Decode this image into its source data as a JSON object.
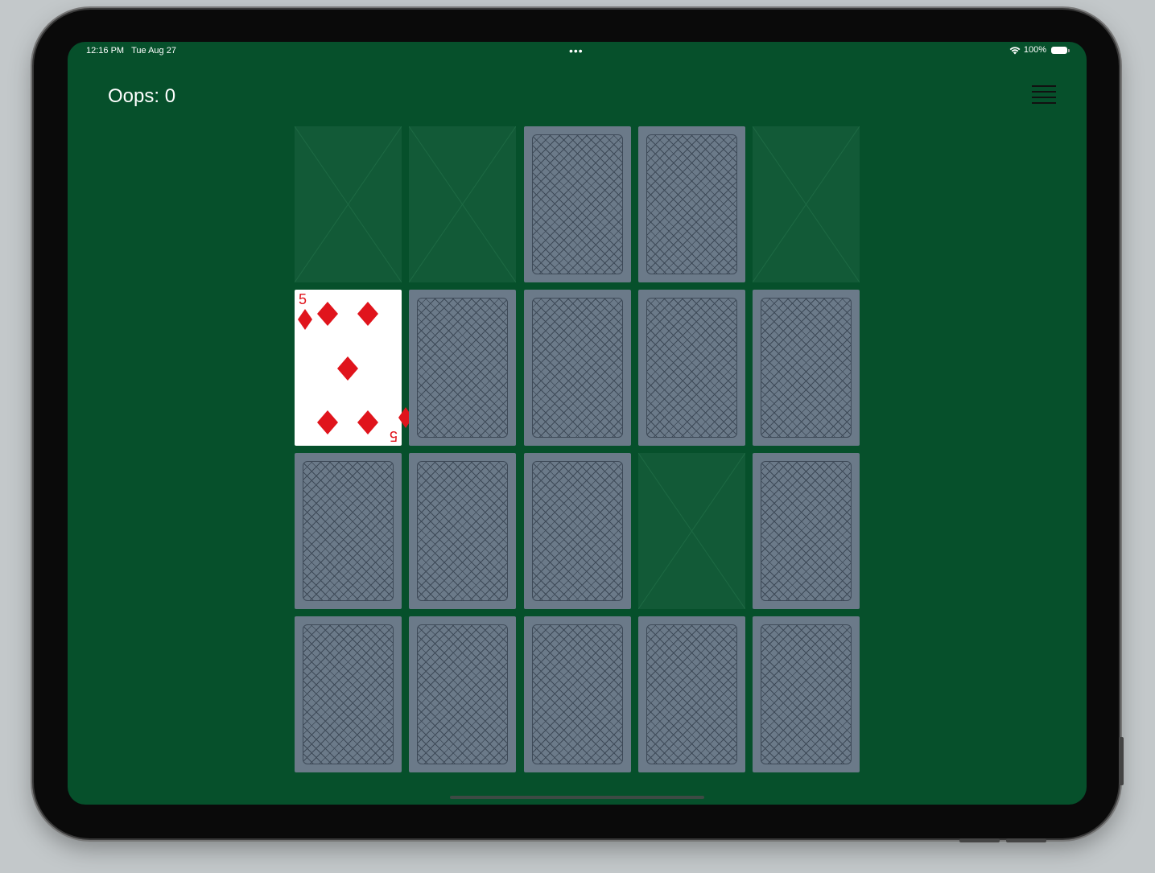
{
  "status_bar": {
    "time": "12:16 PM",
    "date": "Tue Aug 27",
    "dots": "•••",
    "battery": "100%"
  },
  "game": {
    "oops_label": "Oops: 0"
  },
  "menu_icon": "hamburger-menu-icon",
  "colors": {
    "felt": "#06502b",
    "empty_slot": "#125a37",
    "card_back": "#6b7a89",
    "suit_red": "#e0141c"
  },
  "grid": {
    "columns": 5,
    "rows": 4,
    "cards": [
      {
        "state": "empty"
      },
      {
        "state": "empty"
      },
      {
        "state": "face-down"
      },
      {
        "state": "face-down"
      },
      {
        "state": "empty"
      },
      {
        "state": "face-up",
        "rank": "5",
        "suit": "diamonds"
      },
      {
        "state": "face-down"
      },
      {
        "state": "face-down"
      },
      {
        "state": "face-down"
      },
      {
        "state": "face-down"
      },
      {
        "state": "face-down"
      },
      {
        "state": "face-down"
      },
      {
        "state": "face-down"
      },
      {
        "state": "empty"
      },
      {
        "state": "face-down"
      },
      {
        "state": "face-down"
      },
      {
        "state": "face-down"
      },
      {
        "state": "face-down"
      },
      {
        "state": "face-down"
      },
      {
        "state": "face-down"
      }
    ]
  }
}
